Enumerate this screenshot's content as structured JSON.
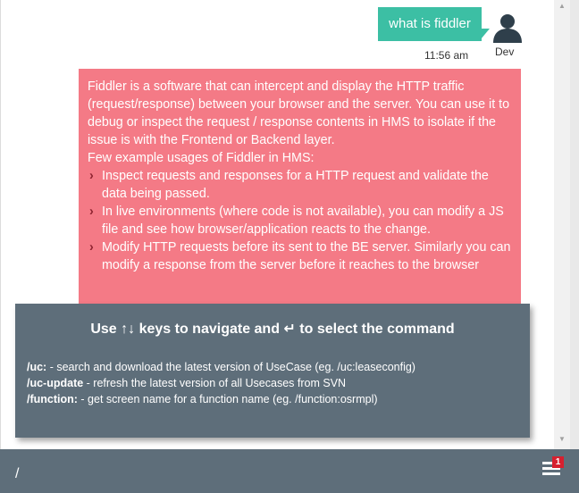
{
  "user_message": {
    "text": "what is fiddler",
    "time": "11:56 am",
    "sender": "Dev"
  },
  "bot_message": {
    "intro": "Fiddler is a software that can intercept and display the HTTP traffic (request/response) between your browser and the server. You can use it to debug or inspect the request / response contents in HMS to isolate if the issue is with the Frontend or Backend layer.",
    "usage_heading": "Few example usages of Fiddler in HMS:",
    "items": [
      "Inspect requests and responses for a HTTP request and validate the data being passed.",
      "In live environments (where code is not available), you can modify a JS file and see how browser/application reacts to the change.",
      "Modify HTTP requests before its sent to the BE server. Similarly you can modify a response from the server before it reaches to the browser"
    ]
  },
  "command_popup": {
    "header": "Use ↑↓ keys to navigate and ↵ to select the command",
    "commands": [
      {
        "cmd": "/uc:",
        "desc": " - search and download the latest version of UseCase (eg. /uc:leaseconfig)"
      },
      {
        "cmd": "/uc-update",
        "desc": " - refresh the latest version of all Usecases from SVN"
      },
      {
        "cmd": "/function:",
        "desc": " - get screen name for a function name (eg. /function:osrmpl)"
      }
    ]
  },
  "input": {
    "value": "/"
  },
  "menu": {
    "badge": "1"
  },
  "colors": {
    "user_bubble": "#3cbfa4",
    "bot_bubble": "#f47a86",
    "popup_bg": "#5e6e7a",
    "badge": "#d6202f"
  }
}
